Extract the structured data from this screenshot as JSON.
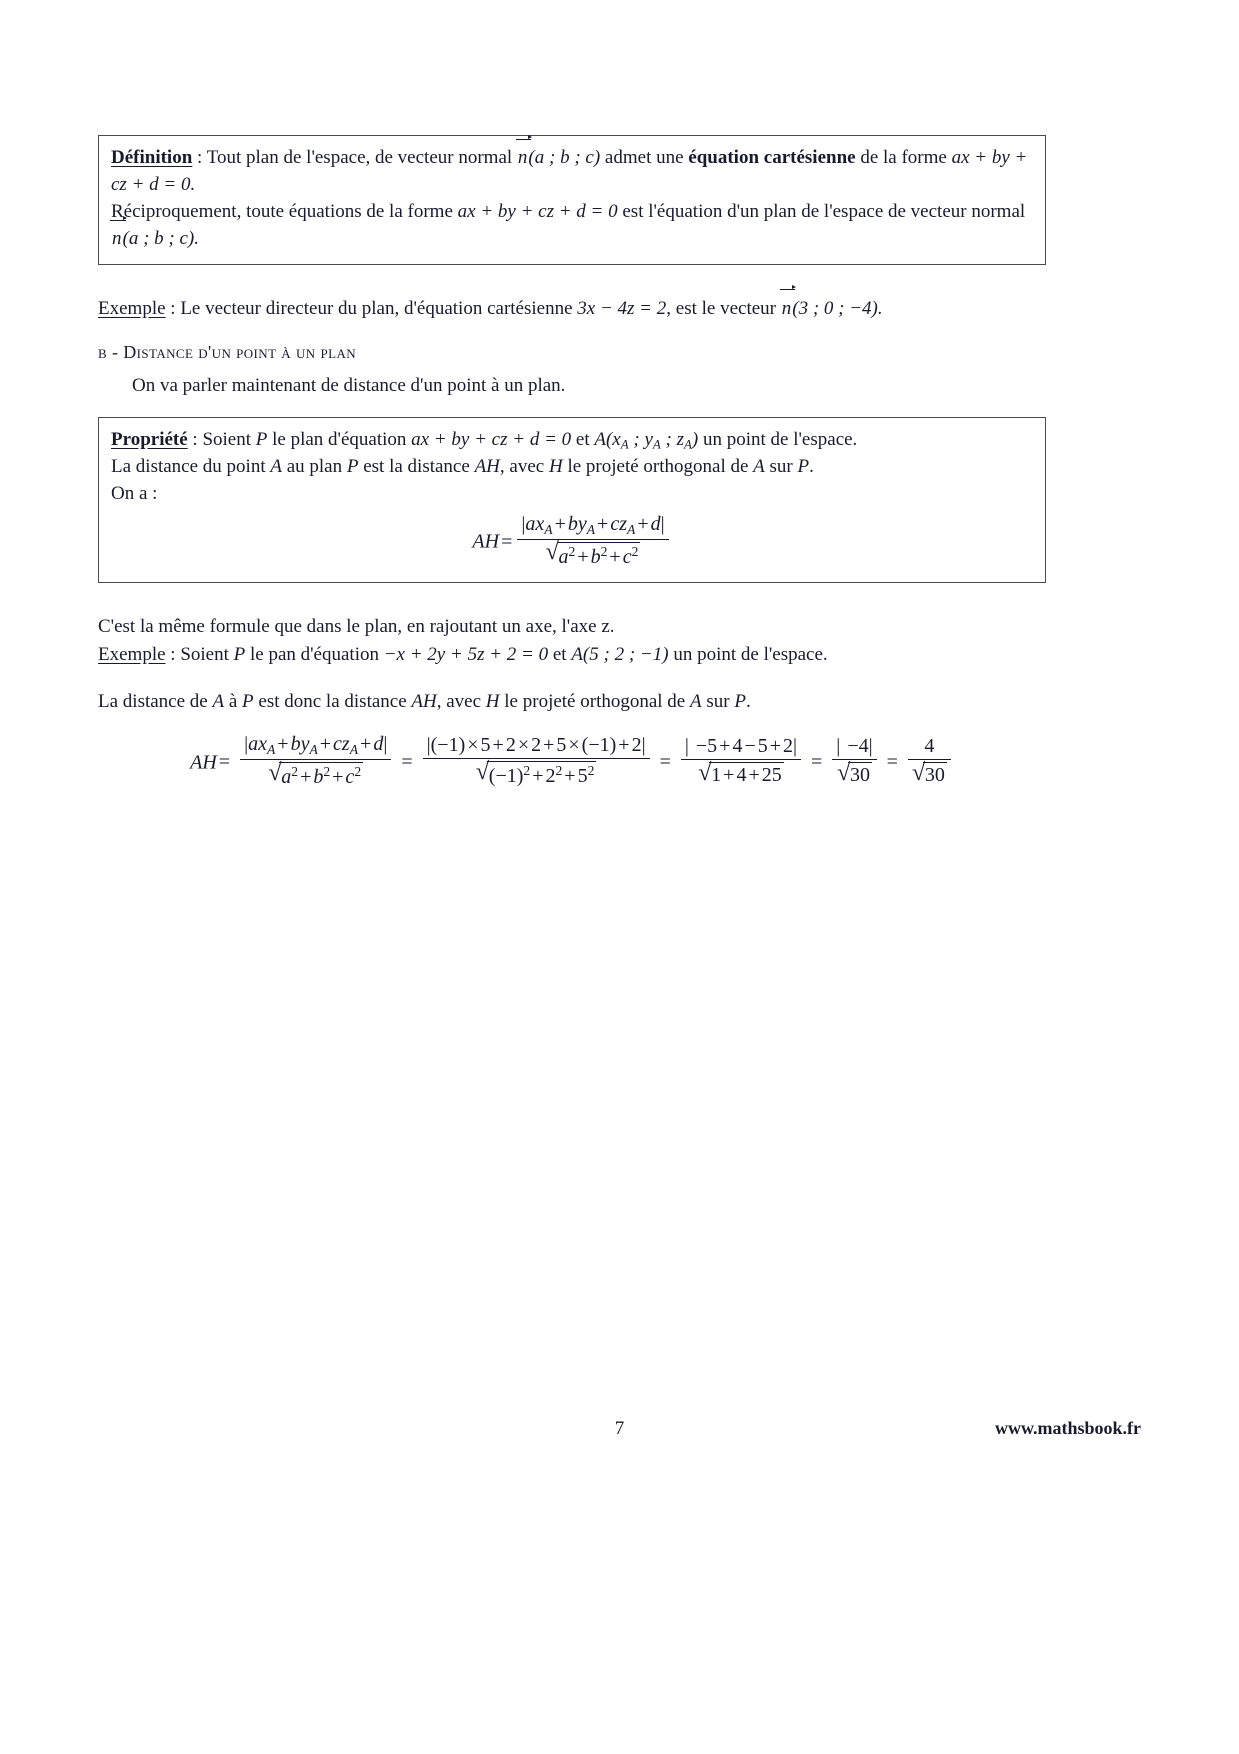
{
  "document": {
    "language": "fr",
    "page_number": "7",
    "website": "www.mathsbook.fr"
  },
  "definition_box": {
    "lead_label": "Définition",
    "colon": " : ",
    "line1_a": "Tout plan de l'espace, de vecteur normal ",
    "vector_n": "n",
    "vector_args": "(a ; b ; c)",
    "line1_b": " admet une ",
    "bold_term": "équation cartésienne",
    "line1_c": " de la forme ",
    "eq_part1": "ax + by +",
    "eq_part2": "cz + d = 0.",
    "line2_a": "Réciproquement, toute équations de la forme ",
    "eq_full": "ax + by + cz + d = 0",
    "line2_b": " est l'équation d'un plan de l'espace de vecteur normal",
    "line3_vector": "n",
    "line3_args": "(a ; b ; c)."
  },
  "example1": {
    "label": "Exemple",
    "colon": " : ",
    "text_a": "Le vecteur directeur du plan, d'équation cartésienne ",
    "equation": "3x − 4z = 2",
    "text_b": ", est le vecteur ",
    "vector_n": "n",
    "vector_args": "(3 ; 0 ; −4)."
  },
  "section_b": {
    "letter": "b",
    "dash": " - ",
    "title": "Distance d'un point à un plan"
  },
  "intro_paragraph": "On va parler maintenant de distance d'un point à un plan.",
  "property_box": {
    "lead_label": "Propriété",
    "colon": " : ",
    "line1_a": "Soient ",
    "plane_symbol": "P",
    "line1_b": " le plan d'équation ",
    "plane_equation": "ax + by + cz + d = 0",
    "line1_c": " et ",
    "point_A": "A",
    "point_A_coords": "(x",
    "point_A_sub1": "A",
    "point_A_sep1": " ; y",
    "point_A_sub2": "A",
    "point_A_sep2": " ; z",
    "point_A_sub3": "A",
    "point_A_close": ")",
    "line1_d": " un point de l'espace.",
    "line2": "La distance du point A au plan P est la distance AH, avec H le projeté orthogonal de A sur P.",
    "line2_a": "La distance du point ",
    "line2_b": " au plan ",
    "line2_c": " est la distance ",
    "line2_AH": "AH",
    "line2_d": ", avec ",
    "line2_H": "H",
    "line2_e": " le projeté orthogonal de ",
    "line2_f": " sur ",
    "line2_g": ".",
    "line3": "On a :",
    "formula": {
      "lhs": "AH",
      "equals": "=",
      "numerator": "|ax_A + by_A + cz_A + d|",
      "denominator": "√(a² + b² + c²)"
    }
  },
  "remark": "C'est la même formule que dans le plan, en rajoutant un axe, l'axe z.",
  "example2": {
    "label": "Exemple",
    "colon": " : ",
    "text_a": "Soient ",
    "plane_symbol": "P",
    "text_b": " le pan d'équation ",
    "plane_equation": "−x + 2y + 5z + 2 = 0",
    "text_c": " et ",
    "point": "A(5 ; 2 ; −1)",
    "text_d": " un point de l'espace."
  },
  "distance_sentence": {
    "a": "La distance de ",
    "A": "A",
    "b": " à ",
    "P": "P",
    "c": " est donc la distance ",
    "AH": "AH",
    "d": ", avec ",
    "H": "H",
    "e": " le projeté orthogonal de ",
    "f": " sur ",
    "g": "."
  },
  "computation": {
    "lhs": "AH",
    "steps": [
      {
        "num": "|ax_A + by_A + cz_A + d|",
        "den": "√(a² + b² + c²)"
      },
      {
        "num": "|(−1) × 5 + 2 × 2 + 5 × (−1) + 2|",
        "den": "√((−1)² + 2² + 5²)"
      },
      {
        "num": "| − 5 + 4 − 5 + 2|",
        "den": "√(1 + 4 + 25)"
      },
      {
        "num": "| − 4|",
        "den": "√30"
      },
      {
        "num": "4",
        "den": "√30"
      }
    ],
    "equals_sign": "="
  },
  "symbols": {
    "sqrt_glyph": "√",
    "abs_bar": "|",
    "minus": "−",
    "times": "×",
    "plus": "+",
    "equals": "=",
    "semicolon": " ; "
  }
}
